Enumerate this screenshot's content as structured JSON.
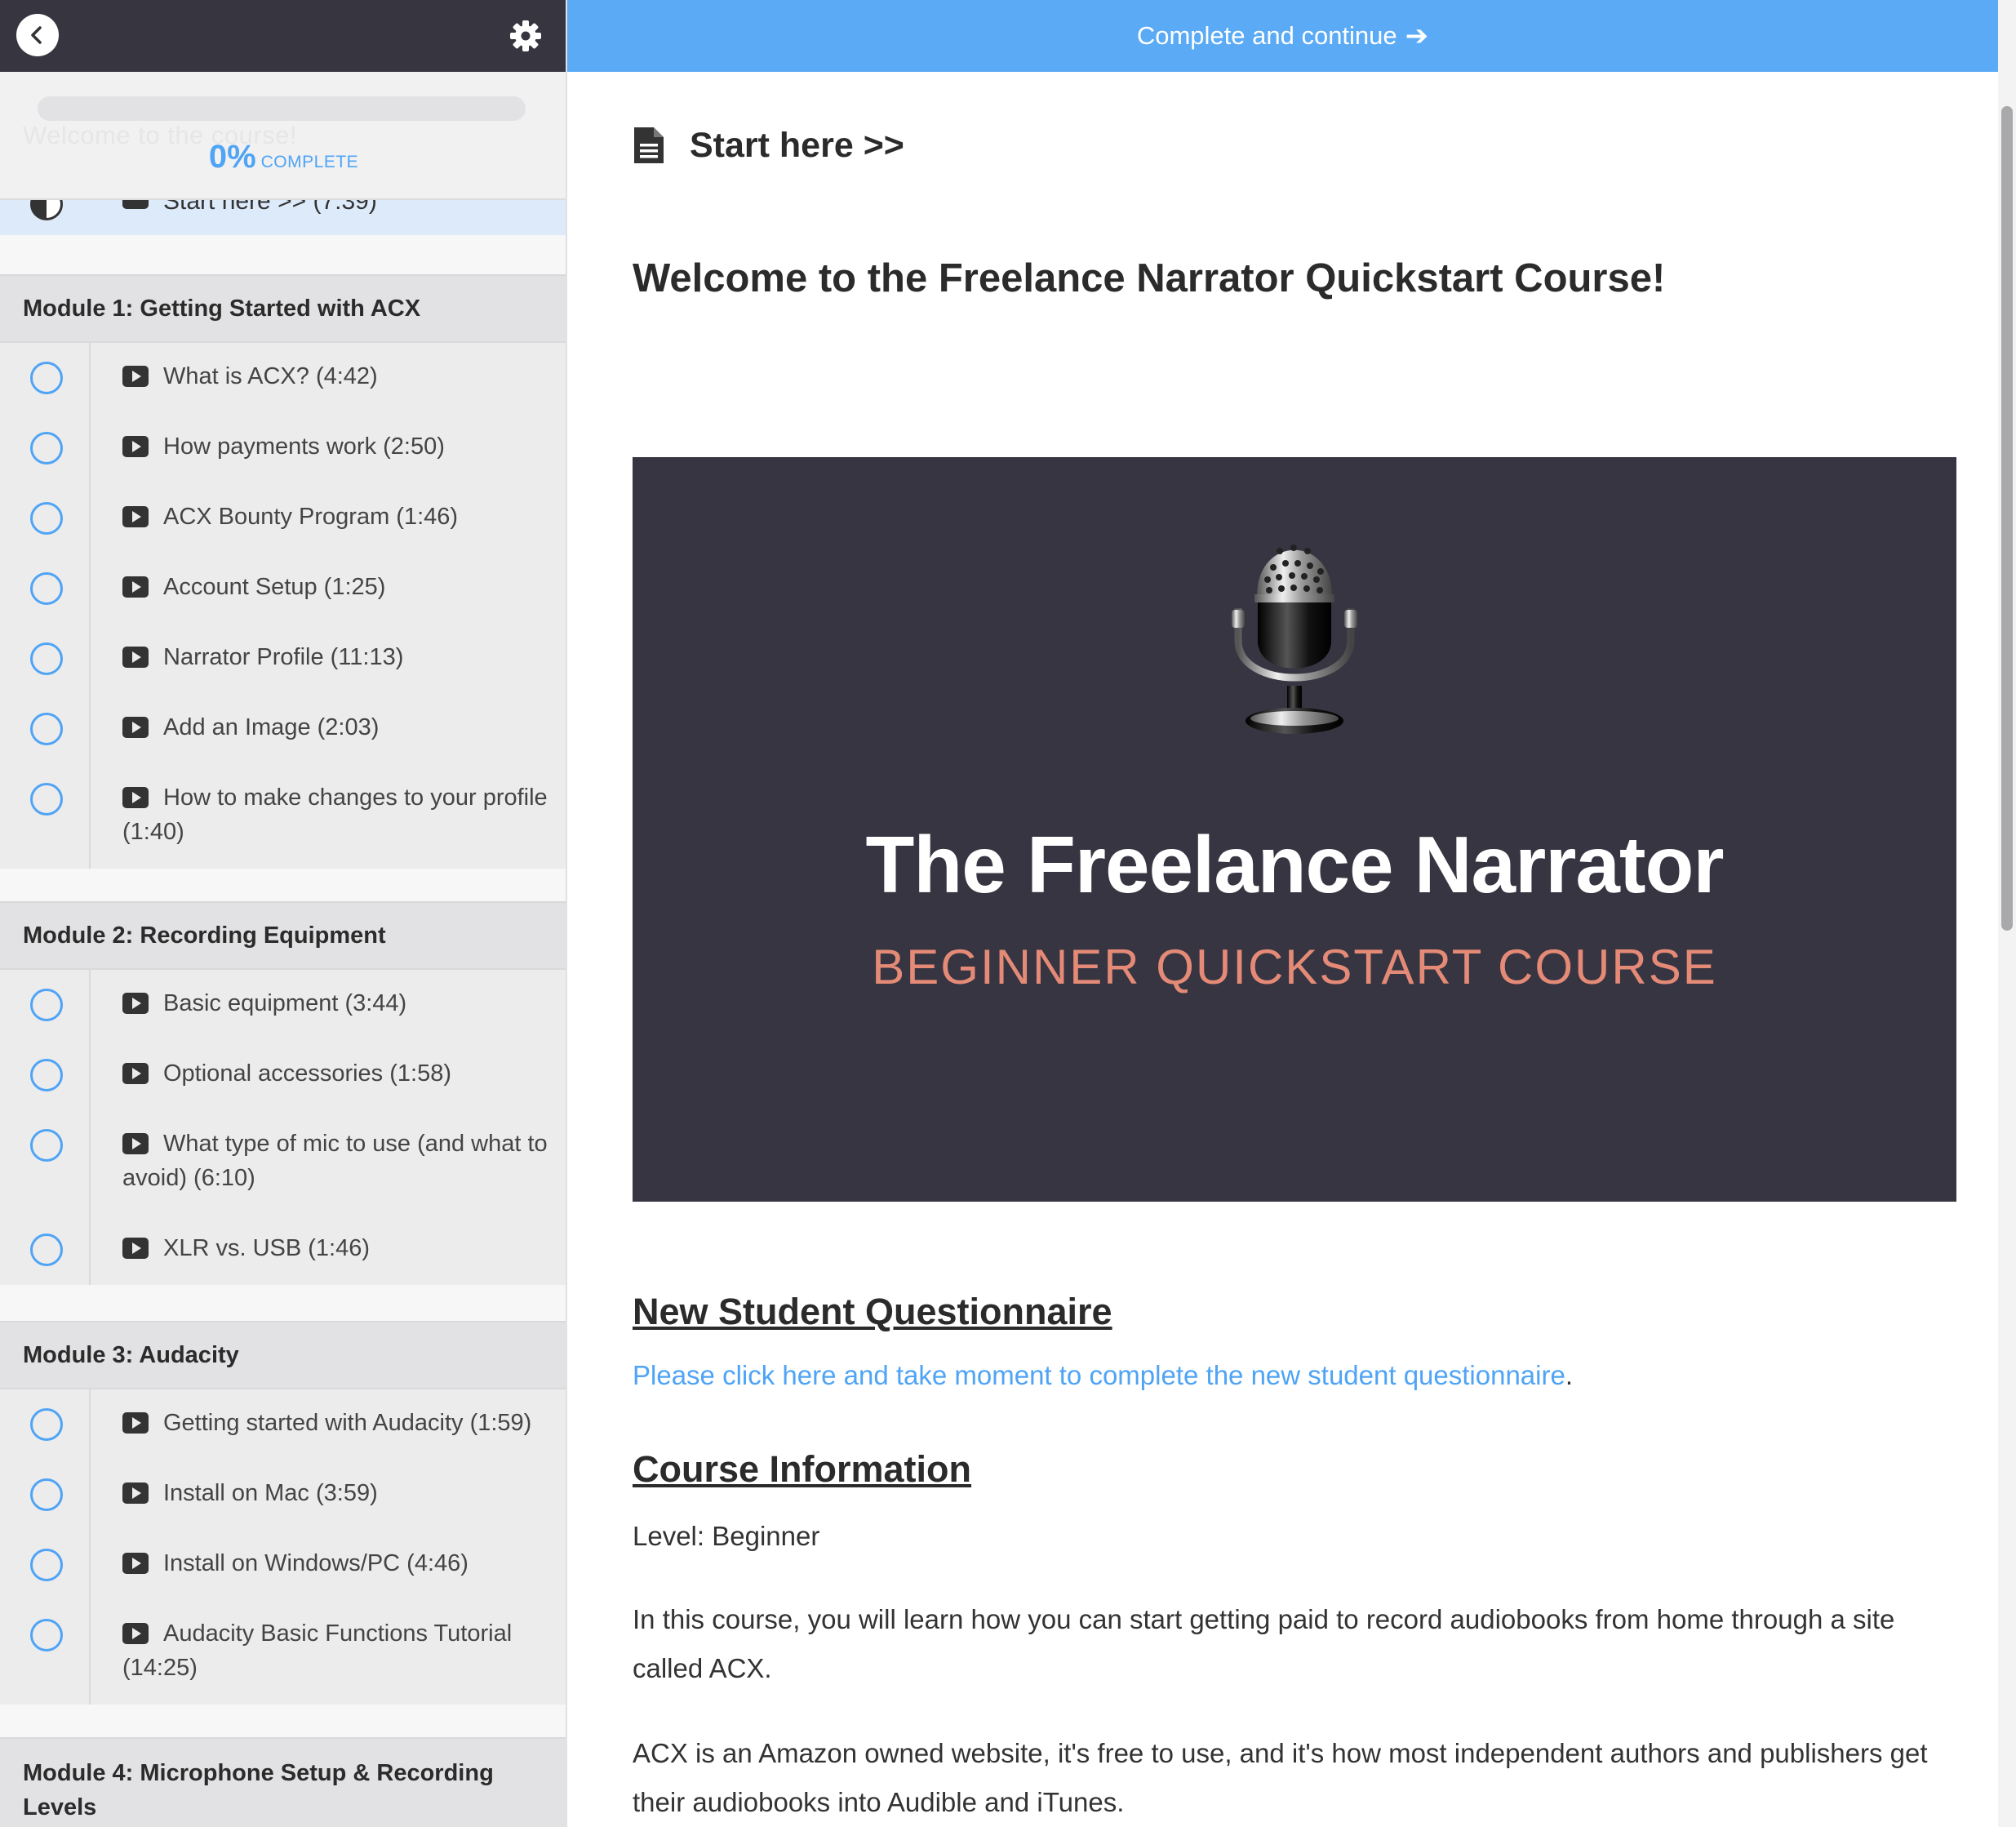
{
  "top_action": {
    "label": "Complete and continue",
    "arrow": "➔"
  },
  "progress": {
    "ghost_text": "Welcome to the course!",
    "percent": "0%",
    "label": "COMPLETE",
    "value": 0
  },
  "current_lesson": {
    "title": "Start here >> (7:39)"
  },
  "modules": [
    {
      "title": "Module 1: Getting Started with ACX",
      "lessons": [
        "What is ACX? (4:42)",
        "How payments work (2:50)",
        "ACX Bounty Program (1:46)",
        "Account Setup (1:25)",
        "Narrator Profile (11:13)",
        "Add an Image (2:03)",
        "How to make changes to your profile (1:40)"
      ]
    },
    {
      "title": "Module 2: Recording Equipment",
      "lessons": [
        "Basic equipment (3:44)",
        "Optional accessories (1:58)",
        "What type of mic to use (and what to avoid) (6:10)",
        "XLR vs. USB (1:46)"
      ]
    },
    {
      "title": "Module 3: Audacity",
      "lessons": [
        "Getting started with Audacity (1:59)",
        "Install on Mac (3:59)",
        "Install on Windows/PC (4:46)",
        "Audacity Basic Functions Tutorial (14:25)"
      ]
    },
    {
      "title": "Module 4: Microphone Setup & Recording Levels",
      "lessons": []
    }
  ],
  "main": {
    "page_title": "Start here >>",
    "welcome_heading": "Welcome to the Freelance Narrator Quickstart Course!",
    "banner": {
      "title": "The Freelance Narrator",
      "subtitle": "BEGINNER QUICKSTART COURSE"
    },
    "questionnaire_heading": "New Student Questionnaire",
    "questionnaire_link": "Please click here and take moment to complete the new student questionnaire",
    "questionnaire_suffix": ".",
    "course_info_heading": "Course Information",
    "level": "Level: Beginner",
    "para1": "In this course, you will learn how you can start getting paid to record audiobooks from home through a site called ACX.",
    "para2": "ACX is an Amazon owned website, it's free to use, and it's how most independent authors and publishers get their audiobooks into Audible and iTunes."
  },
  "colors": {
    "accent": "#5aaaf6",
    "sidebar_dark": "#37353f",
    "banner_bg": "#363541",
    "banner_sub": "#e48a76"
  },
  "icons": [
    "back-icon",
    "gear-icon",
    "half-circle-icon",
    "play-icon",
    "empty-circle-icon",
    "arrow-right-icon",
    "document-icon",
    "microphone-icon"
  ]
}
